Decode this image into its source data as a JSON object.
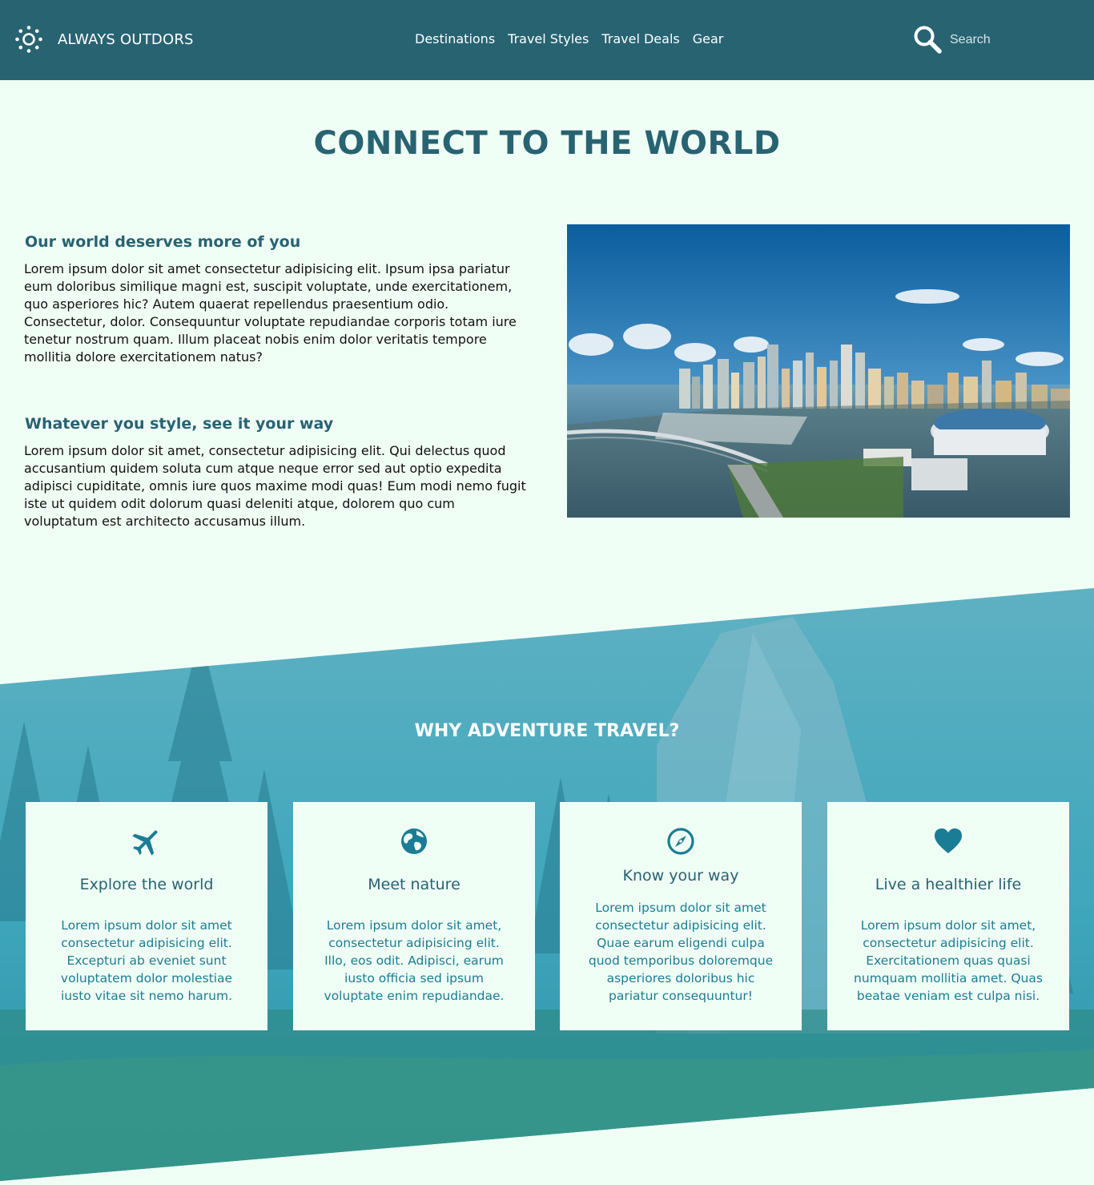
{
  "header": {
    "brand": "ALWAYS OUTDORS",
    "logo_icon": "sun-icon",
    "nav": [
      "Destinations",
      "Travel Styles",
      "Travel Deals",
      "Gear"
    ],
    "search_placeholder": "Search",
    "search_icon": "search-icon"
  },
  "hero": {
    "title": "CONNECT TO THE WORLD",
    "sections": [
      {
        "heading": "Our world deserves more of you",
        "text": "Lorem ipsum dolor sit amet consectetur adipisicing elit. Ipsum ipsa pariatur eum doloribus similique magni est, suscipit voluptate, unde exercitationem, quo asperiores hic? Autem quaerat repellendus praesentium odio. Consectetur, dolor. Consequuntur voluptate repudiandae corporis totam iure tenetur nostrum quam. Illum placeat nobis enim dolor veritatis tempore mollitia dolore exercitationem natus?"
      },
      {
        "heading": "Whatever you style, see it your way",
        "text": "Lorem ipsum dolor sit amet, consectetur adipisicing elit. Qui delectus quod accusantium quidem soluta cum atque neque error sed aut optio expedita adipisci cupiditate, omnis iure quos maxime modi quas! Eum modi nemo fugit iste ut quidem odit dolorum quasi deleniti atque, dolorem quo cum voluptatum est architecto accusamus illum."
      }
    ]
  },
  "adventure": {
    "title": "WHY ADVENTURE TRAVEL?",
    "cards": [
      {
        "icon": "airplane-icon",
        "title": "Explore the world",
        "text": "Lorem ipsum dolor sit amet consectetur adipisicing elit. Excepturi ab eveniet sunt voluptatem dolor molestiae iusto vitae sit nemo harum."
      },
      {
        "icon": "globe-icon",
        "title": "Meet nature",
        "text": "Lorem ipsum dolor sit amet, consectetur adipisicing elit. Illo, eos odit. Adipisci, earum iusto officia sed ipsum voluptate enim repudiandae."
      },
      {
        "icon": "compass-icon",
        "title": "Know your way",
        "text": "Lorem ipsum dolor sit amet consectetur adipisicing elit. Quae earum eligendi culpa quod temporibus doloremque asperiores doloribus hic pariatur consequuntur!"
      },
      {
        "icon": "heart-icon",
        "title": "Live a healthier life",
        "text": "Lorem ipsum dolor sit amet, consectetur adipisicing elit. Exercitationem quas quasi numquam mollitia amet. Quas beatae veniam est culpa nisi."
      }
    ]
  },
  "colors": {
    "header_bg": "#286372",
    "page_bg": "#f0fff5",
    "accent": "#1a7d95",
    "band_overlay": "#4fb3c6"
  }
}
